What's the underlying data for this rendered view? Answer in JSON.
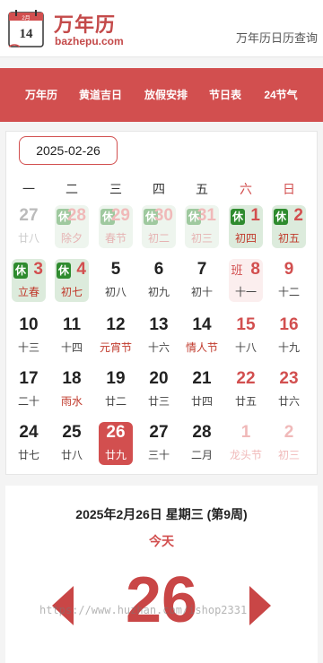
{
  "header": {
    "logo_calendar_day": "14",
    "logo_calendar_month": "2月",
    "title": "万年历",
    "domain": "bazhepu.com",
    "right_link": "万年历日历查询"
  },
  "nav": {
    "items": [
      {
        "label": "万年历",
        "active": true
      },
      {
        "label": "黄道吉日",
        "active": false
      },
      {
        "label": "放假安排",
        "active": false
      },
      {
        "label": "节日表",
        "active": false
      },
      {
        "label": "24节气",
        "active": false
      }
    ]
  },
  "calendar": {
    "selected_date": "2025-02-26",
    "weekdays": [
      "一",
      "二",
      "三",
      "四",
      "五",
      "六",
      "日"
    ],
    "rest_tag": "休",
    "work_tag": "班",
    "weeks": [
      [
        {
          "day": "27",
          "lunar": "廿八",
          "other": true
        },
        {
          "day": "28",
          "lunar": "除夕",
          "other": true,
          "tag": "rest"
        },
        {
          "day": "29",
          "lunar": "春节",
          "other": true,
          "tag": "rest",
          "holiday": true
        },
        {
          "day": "30",
          "lunar": "初二",
          "other": true,
          "tag": "rest"
        },
        {
          "day": "31",
          "lunar": "初三",
          "other": true,
          "tag": "rest"
        },
        {
          "day": "1",
          "lunar": "初四",
          "tag": "rest",
          "weekend": true
        },
        {
          "day": "2",
          "lunar": "初五",
          "tag": "rest",
          "weekend": true
        }
      ],
      [
        {
          "day": "3",
          "lunar": "立春",
          "tag": "rest",
          "holiday": true
        },
        {
          "day": "4",
          "lunar": "初七",
          "tag": "rest"
        },
        {
          "day": "5",
          "lunar": "初八"
        },
        {
          "day": "6",
          "lunar": "初九"
        },
        {
          "day": "7",
          "lunar": "初十"
        },
        {
          "day": "8",
          "lunar": "十一",
          "tag": "work",
          "weekend": true
        },
        {
          "day": "9",
          "lunar": "十二",
          "weekend": true
        }
      ],
      [
        {
          "day": "10",
          "lunar": "十三"
        },
        {
          "day": "11",
          "lunar": "十四"
        },
        {
          "day": "12",
          "lunar": "元宵节",
          "holiday": true
        },
        {
          "day": "13",
          "lunar": "十六"
        },
        {
          "day": "14",
          "lunar": "情人节",
          "holiday": true
        },
        {
          "day": "15",
          "lunar": "十八",
          "weekend": true
        },
        {
          "day": "16",
          "lunar": "十九",
          "weekend": true
        }
      ],
      [
        {
          "day": "17",
          "lunar": "二十"
        },
        {
          "day": "18",
          "lunar": "雨水",
          "holiday": true
        },
        {
          "day": "19",
          "lunar": "廿二"
        },
        {
          "day": "20",
          "lunar": "廿三"
        },
        {
          "day": "21",
          "lunar": "廿四"
        },
        {
          "day": "22",
          "lunar": "廿五",
          "weekend": true
        },
        {
          "day": "23",
          "lunar": "廿六",
          "weekend": true
        }
      ],
      [
        {
          "day": "24",
          "lunar": "廿七"
        },
        {
          "day": "25",
          "lunar": "廿八"
        },
        {
          "day": "26",
          "lunar": "廿九",
          "today": true
        },
        {
          "day": "27",
          "lunar": "三十"
        },
        {
          "day": "28",
          "lunar": "二月"
        },
        {
          "day": "1",
          "lunar": "龙头节",
          "other": true,
          "weekend": true
        },
        {
          "day": "2",
          "lunar": "初三",
          "other": true,
          "weekend": true
        }
      ]
    ]
  },
  "info": {
    "date_line": "2025年2月26日 星期三 (第9周)",
    "today_label": "今天",
    "big_day": "26",
    "watermark": "https://www.huzhan.com/ishop2331"
  },
  "colors": {
    "accent": "#d24f4f",
    "rest_tag": "#2e8b2e",
    "rest_bg": "#dcebdc",
    "work_bg": "#fbeeee"
  },
  "icons": {
    "logo": "calendar-icon",
    "prev": "left-arrow-icon",
    "next": "right-arrow-icon"
  }
}
